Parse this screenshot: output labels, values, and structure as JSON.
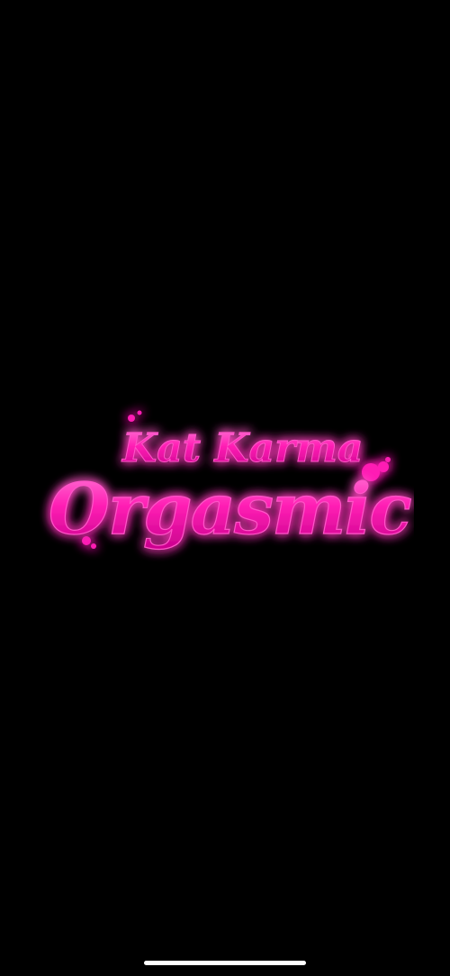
{
  "splash": {
    "artist": "Kat Karma",
    "title": "Orgasmic",
    "logo_color": "#ff1fb4",
    "glow_color": "#c0008a",
    "highlight_color": "#ffb3ea",
    "background_color": "#000000"
  },
  "home_indicator": {
    "color": "#ffffff"
  }
}
